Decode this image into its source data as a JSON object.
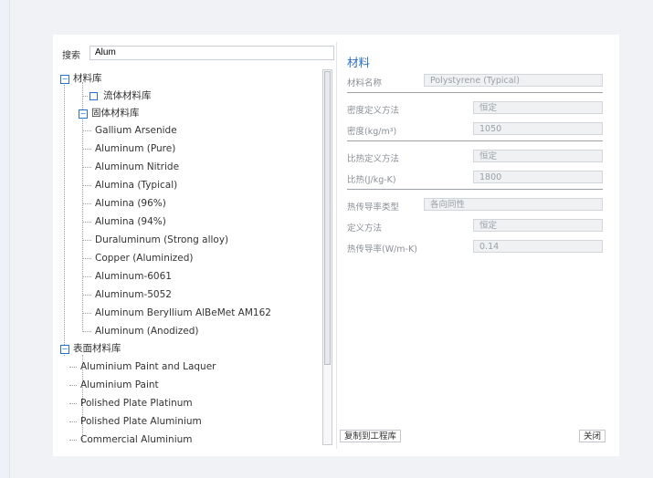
{
  "search": {
    "label": "搜索",
    "value": "Alum"
  },
  "tree": {
    "root": "材料库",
    "fluid": "流体材料库",
    "solid": "固体材料库",
    "solid_items": [
      "Gallium Arsenide",
      "Aluminum (Pure)",
      "Aluminum Nitride",
      "Alumina (Typical)",
      "Alumina (96%)",
      "Alumina (94%)",
      "Duraluminum (Strong alloy)",
      "Copper (Aluminized)",
      "Aluminum-6061",
      "Aluminum-5052",
      "Aluminum Beryllium AlBeMet AM162",
      "Aluminum (Anodized)"
    ],
    "surface": "表面材料库",
    "surface_items": [
      "Aluminium Paint and Laquer",
      "Aluminium Paint",
      "Polished Plate Platinum",
      "Polished Plate Aluminium",
      "Commercial Aluminium"
    ],
    "expander_open": "−"
  },
  "material": {
    "title": "材料",
    "name_label": "材料名称",
    "name_value": "Polystyrene (Typical)",
    "density_method_label": "密度定义方法",
    "density_method_value": "恒定",
    "density_label": "密度(kg/m³)",
    "density_value": "1050",
    "specific_heat_method_label": "比热定义方法",
    "specific_heat_method_value": "恒定",
    "specific_heat_label": "比热(J/kg-K)",
    "specific_heat_value": "1800",
    "conductivity_type_label": "热传导率类型",
    "conductivity_type_value": "各向同性",
    "definition_method_label": "定义方法",
    "definition_method_value": "恒定",
    "conductivity_label": "热传导率(W/m-K)",
    "conductivity_value": "0.14"
  },
  "buttons": {
    "copy": "复制到工程库",
    "close": "关闭"
  }
}
